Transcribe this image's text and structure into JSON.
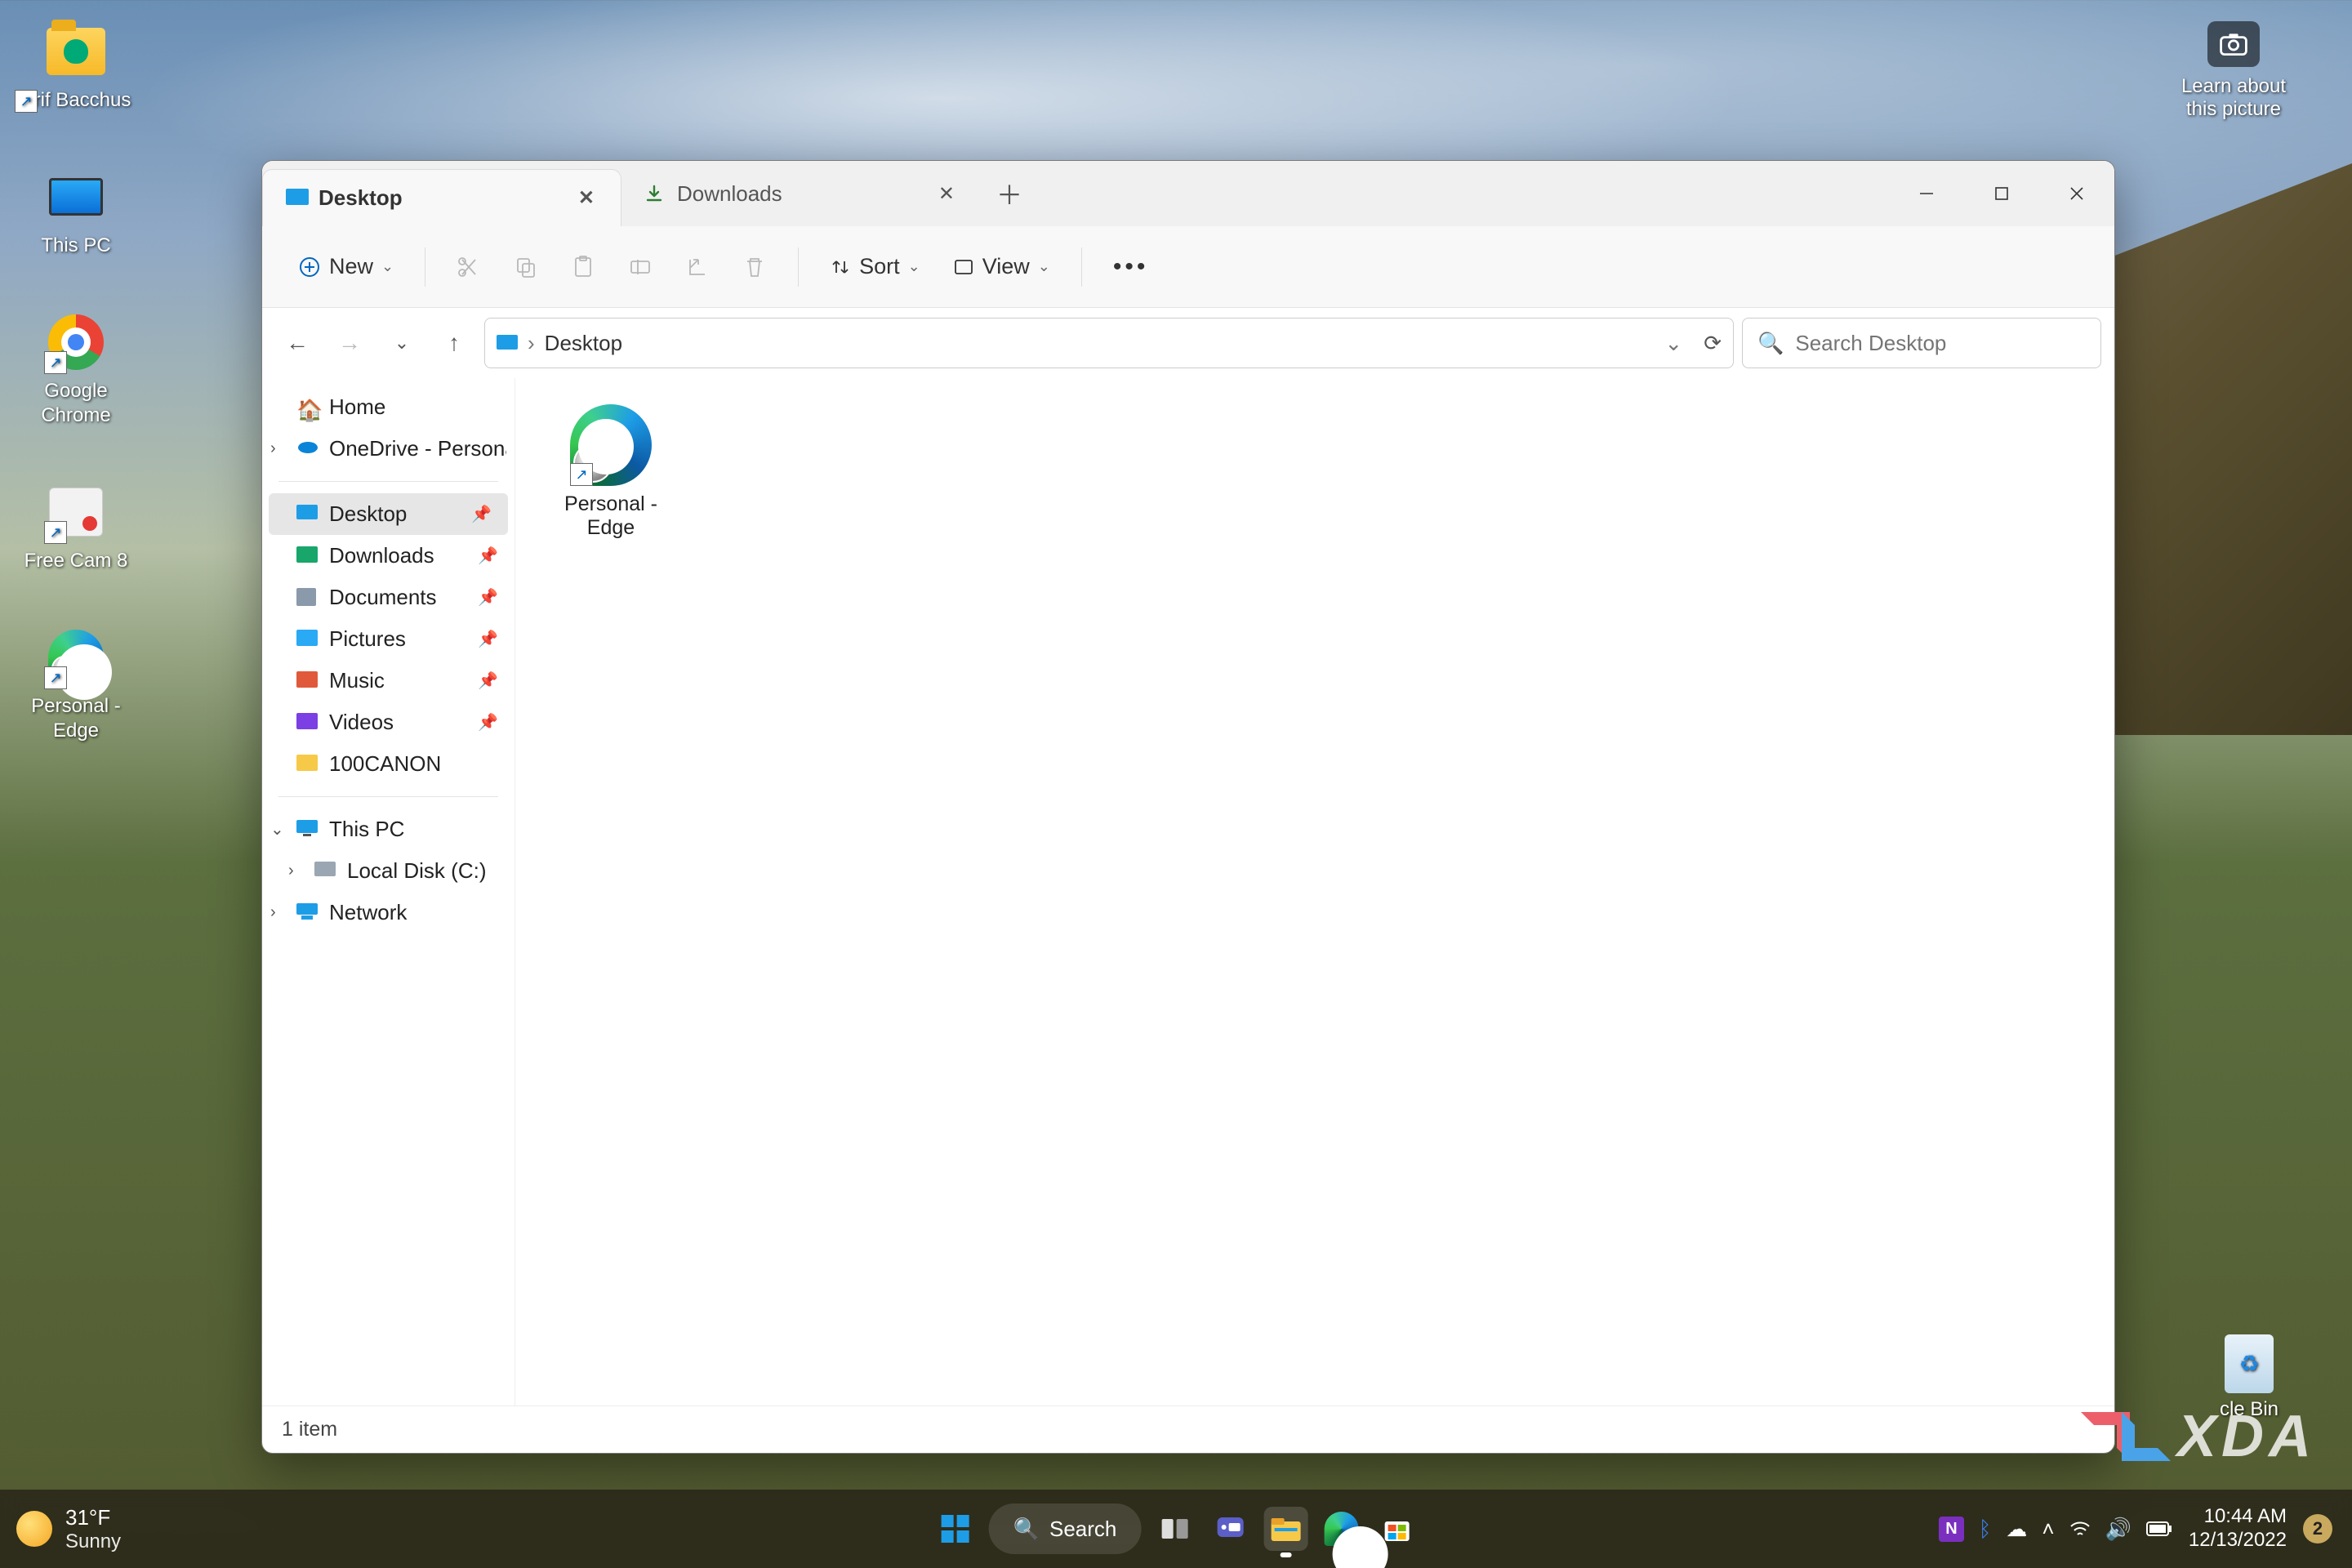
{
  "desktop_icons": {
    "user_folder": "Arif Bacchus",
    "this_pc": "This PC",
    "chrome": "Google Chrome",
    "freecam": "Free Cam 8",
    "edge_personal": "Personal - Edge"
  },
  "spotlight": {
    "line1": "Learn about",
    "line2": "this picture"
  },
  "recycle_bin": "cle Bin",
  "explorer": {
    "tabs": [
      {
        "label": "Desktop",
        "active": true
      },
      {
        "label": "Downloads",
        "active": false
      }
    ],
    "toolbar": {
      "new": "New",
      "sort": "Sort",
      "view": "View"
    },
    "address": {
      "location": "Desktop"
    },
    "search": {
      "placeholder": "Search Desktop"
    },
    "sidebar": {
      "home": "Home",
      "onedrive": "OneDrive - Persona",
      "quick": {
        "desktop": "Desktop",
        "downloads": "Downloads",
        "documents": "Documents",
        "pictures": "Pictures",
        "music": "Music",
        "videos": "Videos",
        "canon": "100CANON"
      },
      "this_pc": "This PC",
      "local_disk": "Local Disk (C:)",
      "network": "Network"
    },
    "content": {
      "items": [
        {
          "name": "Personal - Edge"
        }
      ]
    },
    "statusbar": "1 item"
  },
  "taskbar": {
    "weather": {
      "temp": "31°F",
      "cond": "Sunny"
    },
    "search": "Search",
    "clock": {
      "time": "10:44 AM",
      "date": "12/13/2022"
    },
    "badge": "2"
  },
  "watermark": "XDA"
}
